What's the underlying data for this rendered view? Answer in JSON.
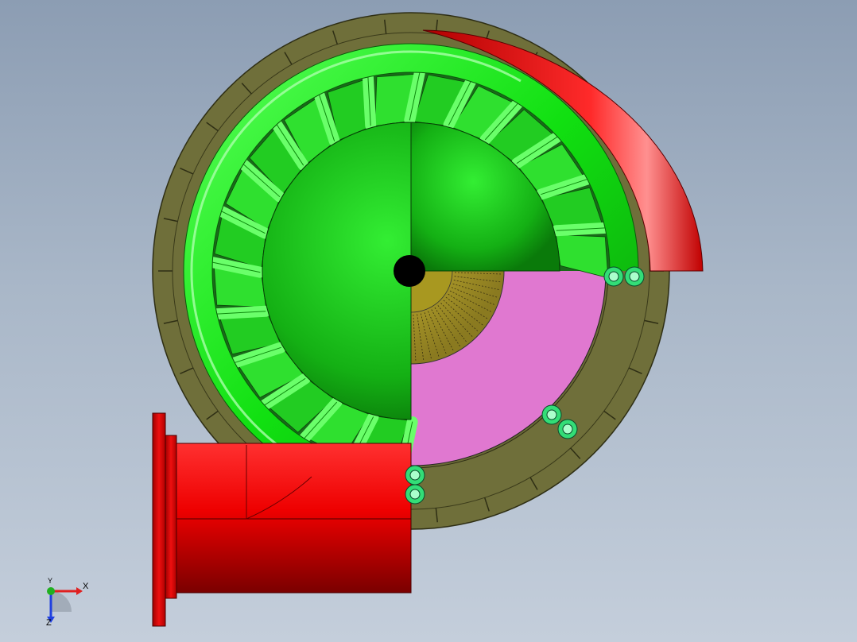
{
  "view": {
    "background_top": "#8c9db3",
    "background_bottom": "#c4cedb"
  },
  "model": {
    "parts": [
      {
        "name": "volute-casing",
        "color": "#6f6f3a"
      },
      {
        "name": "runner-shroud-ring",
        "color": "#11ee11"
      },
      {
        "name": "runner-blades",
        "color": "#22dd22"
      },
      {
        "name": "hub-cone",
        "color": "#18c818"
      },
      {
        "name": "scroll-tongue",
        "color": "#dd0000"
      },
      {
        "name": "inlet-pipe",
        "color": "#ee0000"
      },
      {
        "name": "draft-tube-section",
        "color": "#e078d0"
      },
      {
        "name": "bearing-cone",
        "color": "#b0a018"
      },
      {
        "name": "bolt-fittings",
        "color": "#33dd77"
      }
    ]
  },
  "triad": {
    "x_label": "X",
    "y_label": "Y",
    "z_label": "Z",
    "x_color": "#e02020",
    "y_color": "#20b020",
    "z_color": "#2040e0"
  }
}
